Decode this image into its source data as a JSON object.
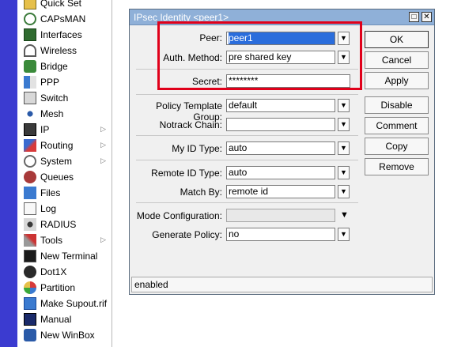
{
  "sidebar": {
    "items": [
      {
        "label": "Quick Set",
        "icon": "quick-set-icon",
        "submenu": false
      },
      {
        "label": "CAPsMAN",
        "icon": "capsman-icon",
        "submenu": false
      },
      {
        "label": "Interfaces",
        "icon": "interfaces-icon",
        "submenu": false
      },
      {
        "label": "Wireless",
        "icon": "wireless-icon",
        "submenu": false
      },
      {
        "label": "Bridge",
        "icon": "bridge-icon",
        "submenu": false
      },
      {
        "label": "PPP",
        "icon": "ppp-icon",
        "submenu": false
      },
      {
        "label": "Switch",
        "icon": "switch-icon",
        "submenu": false
      },
      {
        "label": "Mesh",
        "icon": "mesh-icon",
        "submenu": false
      },
      {
        "label": "IP",
        "icon": "ip-icon",
        "submenu": true
      },
      {
        "label": "Routing",
        "icon": "routing-icon",
        "submenu": true
      },
      {
        "label": "System",
        "icon": "system-icon",
        "submenu": true
      },
      {
        "label": "Queues",
        "icon": "queues-icon",
        "submenu": false
      },
      {
        "label": "Files",
        "icon": "files-icon",
        "submenu": false
      },
      {
        "label": "Log",
        "icon": "log-icon",
        "submenu": false
      },
      {
        "label": "RADIUS",
        "icon": "radius-icon",
        "submenu": false
      },
      {
        "label": "Tools",
        "icon": "tools-icon",
        "submenu": true
      },
      {
        "label": "New Terminal",
        "icon": "terminal-icon",
        "submenu": false
      },
      {
        "label": "Dot1X",
        "icon": "dot1x-icon",
        "submenu": false
      },
      {
        "label": "Partition",
        "icon": "partition-icon",
        "submenu": false
      },
      {
        "label": "Make Supout.rif",
        "icon": "supout-icon",
        "submenu": false
      },
      {
        "label": "Manual",
        "icon": "manual-icon",
        "submenu": false
      },
      {
        "label": "New WinBox",
        "icon": "winbox-icon",
        "submenu": false
      }
    ]
  },
  "dialog": {
    "title": "IPsec Identity <peer1>",
    "fields": {
      "peer": {
        "label": "Peer:",
        "value": "peer1"
      },
      "auth_method": {
        "label": "Auth. Method:",
        "value": "pre shared key"
      },
      "secret": {
        "label": "Secret:",
        "value": "********"
      },
      "policy_template_group": {
        "label": "Policy Template Group:",
        "value": "default"
      },
      "notrack_chain": {
        "label": "Notrack Chain:",
        "value": ""
      },
      "my_id_type": {
        "label": "My ID Type:",
        "value": "auto"
      },
      "remote_id_type": {
        "label": "Remote ID Type:",
        "value": "auto"
      },
      "match_by": {
        "label": "Match By:",
        "value": "remote id"
      },
      "mode_configuration": {
        "label": "Mode Configuration:",
        "value": ""
      },
      "generate_policy": {
        "label": "Generate Policy:",
        "value": "no"
      }
    },
    "buttons": {
      "ok": "OK",
      "cancel": "Cancel",
      "apply": "Apply",
      "disable": "Disable",
      "comment": "Comment",
      "copy": "Copy",
      "remove": "Remove"
    },
    "status": "enabled"
  },
  "colors": {
    "left_band": "#3b3bd0",
    "titlebar": "#8fb0d8",
    "selection": "#2a6ddc",
    "highlight_box": "#e0001a"
  }
}
